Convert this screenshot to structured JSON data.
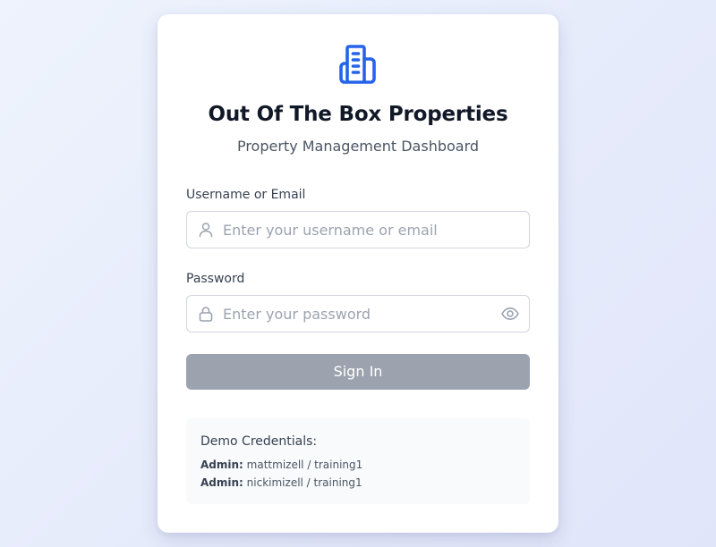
{
  "header": {
    "logo_icon": "building-icon",
    "brand_color": "#2563eb",
    "title": "Out Of The Box Properties",
    "subtitle": "Property Management Dashboard"
  },
  "form": {
    "username": {
      "label": "Username or Email",
      "placeholder": "Enter your username or email",
      "value": "",
      "icon": "user-icon"
    },
    "password": {
      "label": "Password",
      "placeholder": "Enter your password",
      "value": "",
      "icon": "lock-icon",
      "toggle_icon": "eye-icon"
    },
    "submit": {
      "label": "Sign In",
      "color": "#9ca3af"
    }
  },
  "demo": {
    "title": "Demo Credentials:",
    "entries": [
      {
        "role": "Admin:",
        "credentials": "mattmizell / training1"
      },
      {
        "role": "Admin:",
        "credentials": "nickimizell / training1"
      }
    ]
  }
}
